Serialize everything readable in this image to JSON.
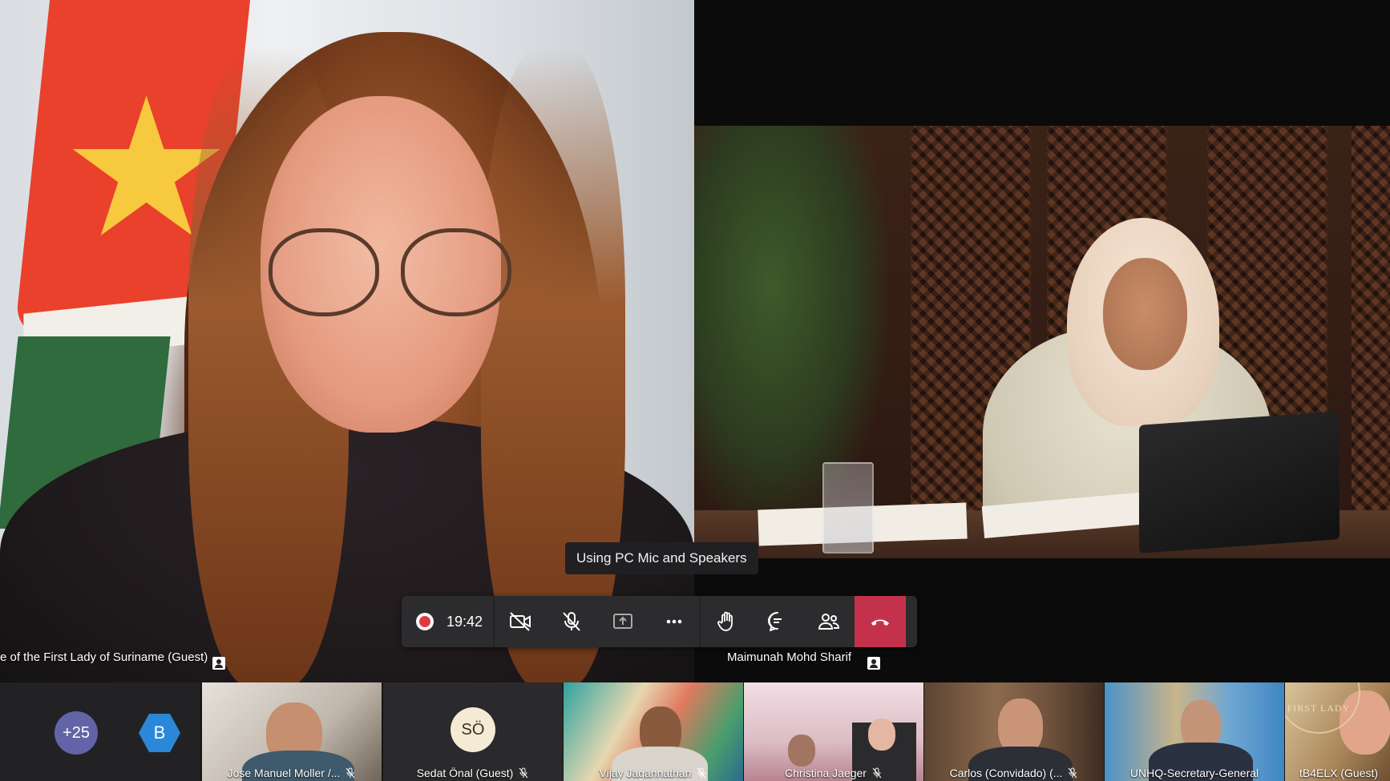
{
  "left_video": {
    "name": "e of the First Lady of Suriname (Guest)"
  },
  "right_video": {
    "name": "Maimunah Mohd Sharif"
  },
  "toast": {
    "text": "Using PC Mic and Speakers"
  },
  "control_bar": {
    "timer": "19:42",
    "icons": [
      "record-icon",
      "camera-off-icon",
      "mic-off-icon",
      "share-screen-icon",
      "more-icon",
      "raise-hand-icon",
      "chat-icon",
      "people-icon",
      "hangup-icon"
    ]
  },
  "bottom_strip": {
    "overflow": {
      "count": "+25",
      "avatar_initial": "B"
    },
    "thumbs": [
      {
        "name": "Jose Manuel Moller /..."
      },
      {
        "name": "Sedat Önal (Guest)",
        "initials": "SÖ"
      },
      {
        "name": "Vijay Jagannathan"
      },
      {
        "name": "Christina Jaeger"
      },
      {
        "name": "Carlos (Convidado) (..."
      },
      {
        "name": "UNHQ-Secretary-General"
      },
      {
        "name": "tB4ELX (Guest)"
      }
    ],
    "seal_text": "FIRST LADY"
  },
  "colors": {
    "background": "#0b0b0c",
    "control_bar": "#2c2c2f",
    "hangup": "#c4314b",
    "overflow_badge": "#6264a7",
    "avatar_b": "#2b88d8",
    "sedat_avatar": "#f5ead4"
  }
}
